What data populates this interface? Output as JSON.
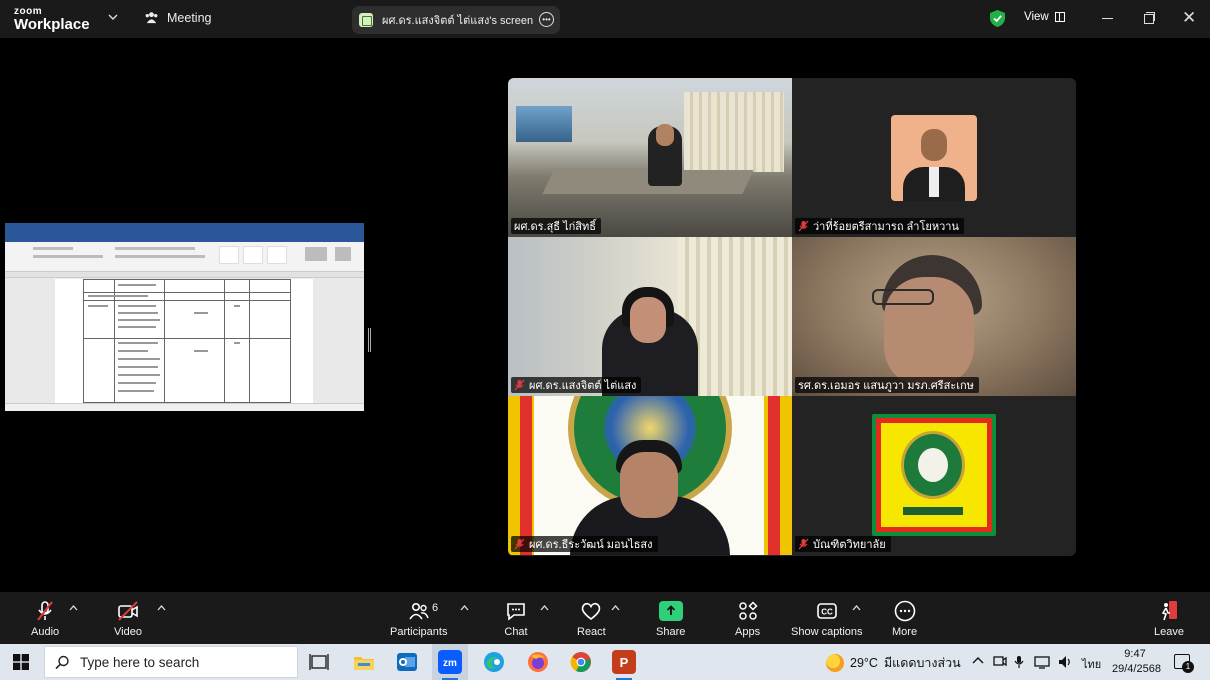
{
  "titlebar": {
    "brand_top": "zoom",
    "brand_bottom": "Workplace",
    "meeting_label": "Meeting",
    "share_label": "ผศ.ดร.แสงจิตต์ ไต่แสง's screen",
    "view_label": "View"
  },
  "participants": [
    {
      "name": "ผศ.ดร.สุธี ไก่สิทธิ์",
      "muted": false
    },
    {
      "name": "ว่าที่ร้อยตรีสามารถ ลำโยหวาน",
      "muted": true
    },
    {
      "name": "ผศ.ดร.แสงจิตต์ ไต่แสง",
      "muted": true
    },
    {
      "name": "รศ.ดร.เอมอร แสนภูวา มรภ.ศรีสะเกษ",
      "muted": false,
      "speaking": true
    },
    {
      "name": "ผศ.ดร.ธีระวัฒน์ มอนไธสง",
      "muted": true
    },
    {
      "name": "บัณฑิตวิทยาลัย",
      "muted": true
    }
  ],
  "controls": {
    "audio": "Audio",
    "video": "Video",
    "participants": "Participants",
    "participants_count": "6",
    "chat": "Chat",
    "react": "React",
    "share": "Share",
    "apps": "Apps",
    "captions": "Show captions",
    "more": "More",
    "leave": "Leave"
  },
  "taskbar": {
    "search_placeholder": "Type here to search",
    "weather_temp": "29°C",
    "weather_desc": "มีแดดบางส่วน",
    "language": "ไทย",
    "time": "9:47",
    "date": "29/4/2568",
    "notification_count": "1"
  },
  "colors": {
    "accent_green": "#2fd07a",
    "muted_red": "#e23b3b",
    "zoom_blue": "#2d8cff"
  }
}
